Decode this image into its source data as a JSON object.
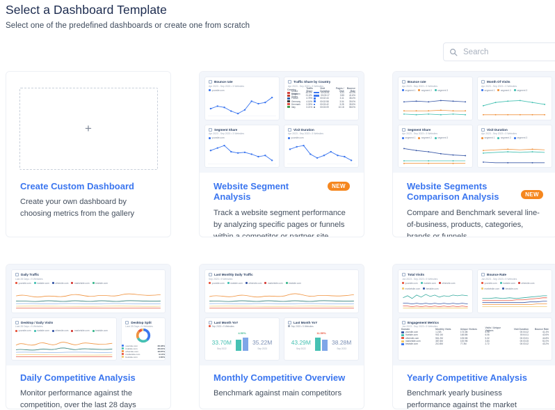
{
  "header": {
    "title": "Select a Dashboard Template",
    "subtitle": "Select one of the predefined dashboards or create one from scratch"
  },
  "search": {
    "placeholder": "Search",
    "value": "",
    "icon": "search-icon"
  },
  "badge_label": "NEW",
  "colors": {
    "link": "#3b76ef",
    "badge": "#f5871f",
    "title": "#1b2a4e",
    "thumb_bg": "#f3f6fb",
    "teal": "#46c1b3",
    "blue": "#7ea6e8",
    "orange": "#f0933f",
    "red": "#e8553e",
    "green": "#3fb98f"
  },
  "cards": [
    {
      "id": "create-custom-dashboard",
      "title": "Create Custom Dashboard",
      "description": "Create your own dashboard by choosing metrics from the gallery",
      "badge": null,
      "thumb_type": "blank",
      "plus_icon": "plus-icon"
    },
    {
      "id": "website-segment-analysis",
      "title": "Website Segment Analysis",
      "description": "Track a website segment performance by analyzing specific pages or funnels within a competitor or partner site",
      "badge": "NEW",
      "thumb_type": "panels",
      "panels": [
        {
          "name": "Bounce rate",
          "sub": "Apr 2023 - Sep 2023  •  3 Websites",
          "legend": [
            "yoursite.com"
          ],
          "type": "line"
        },
        {
          "name": "Traffic Share by Country",
          "sub": "Apr 2023 - Sep 2023  •  3 Websites",
          "type": "table",
          "columns": [
            "Country",
            "Traffic Share",
            "Visit Duration",
            "Pages / Visit",
            "Bounce Rate"
          ],
          "rows": [
            [
              "United Kingdom",
              "44.0%",
              "00:03:51",
              "4.21",
              "40.1%"
            ],
            [
              "United States",
              "21.6%",
              "00:03:17",
              "3.55",
              "41.6%"
            ],
            [
              "France",
              "4.78%",
              "00:02:44",
              "3.11",
              "38.4%"
            ],
            [
              "Germany",
              "4.16%",
              "00:02:58",
              "3.04",
              "39.0%"
            ],
            [
              "Denmark",
              "3.39%",
              "00:03:42",
              "3.28",
              "35.5%"
            ],
            [
              "Italy",
              "3.21%",
              "00:03:09",
              "10.18",
              "58.0%"
            ]
          ]
        },
        {
          "name": "Segment Share",
          "sub": "Apr 2023 - Sep 2023  •  3 Websites",
          "legend": [
            "yoursite.com"
          ],
          "type": "line"
        },
        {
          "name": "Visit Duration",
          "sub": "Apr 2023 - Sep 2023  •  3 Websites",
          "legend": [
            "yoursite.com"
          ],
          "type": "line"
        }
      ]
    },
    {
      "id": "website-segments-comparison-analysis",
      "title": "Website Segments Comparison Analysis",
      "description": "Compare and Benchmark several line-of-business, products, categories, brands or funnels",
      "badge": "NEW",
      "thumb_type": "panels",
      "panels": [
        {
          "name": "Bounce rate",
          "sub": "Apr 2023 - Sep 2023  •  3 Websites",
          "legend": [
            "segment 1",
            "segment 2",
            "segment 3"
          ],
          "type": "line-multi"
        },
        {
          "name": "Month Of Visits",
          "sub": "Apr 2023 - Sep 2023  •  3 Websites",
          "legend": [
            "segment 1",
            "segment 2",
            "segment 3"
          ],
          "type": "line-multi"
        },
        {
          "name": "Segment Share",
          "sub": "Apr 2023 - Sep 2023  •  3 Websites",
          "legend": [
            "segment 1",
            "segment 2",
            "segment 3"
          ],
          "type": "line-multi"
        },
        {
          "name": "Visit Duration",
          "sub": "Apr 2023 - Sep 2023  •  3 Websites",
          "legend": [
            "segment 1",
            "segment 2",
            "segment 3"
          ],
          "type": "line-multi"
        }
      ]
    },
    {
      "id": "daily-competitive-analysis",
      "title": "Daily Competitive Analysis",
      "description": "Monitor performance against the competition, over the last 28 days",
      "badge": null,
      "thumb_type": "panels",
      "panels": [
        {
          "name": "Daily Traffic",
          "sub": "Last 28 Days  •  5 Websites",
          "legend": [
            "yoursite.com",
            "rivalsite.com",
            "othersite.com",
            "marketsite.com",
            "bestsite.com"
          ],
          "type": "area-multi"
        },
        {
          "name": "Desktop / Daily Visits",
          "sub": "Last 28 Days  •  5 Websites",
          "legend": [
            "yoursite.com",
            "rivalsite.com",
            "othersite.com",
            "marketsite.com",
            "bestsite.com"
          ],
          "type": "area-multi"
        },
        {
          "name": "Desktop Split",
          "sub": "Last 28 Days  •  5 Websites",
          "type": "donut",
          "slices": [
            {
              "label": "yoursite.com",
              "value": "38.48%"
            },
            {
              "label": "rivalsite.com",
              "value": "28.91%"
            },
            {
              "label": "othersite.com",
              "value": "18.87%"
            },
            {
              "label": "marketsite.com",
              "value": "9.14%"
            },
            {
              "label": "bestsite.com",
              "value": "4.60%"
            }
          ]
        }
      ]
    },
    {
      "id": "monthly-competitive-overview",
      "title": "Monthly Competitive Overview",
      "description": "Benchmark against main competitors",
      "badge": null,
      "thumb_type": "panels",
      "panels": [
        {
          "name": "Last Monthly Daily Traffic",
          "sub": "Sep 2023  •  5 Websites",
          "legend": [
            "yoursite.com",
            "rivalsite.com",
            "othersite.com",
            "marketsite.com",
            "bestsite.com"
          ],
          "type": "area-multi"
        },
        {
          "name": "Last Month YoY",
          "sub": "Sep 2023  •  5 Websites",
          "type": "kpi",
          "left_value": "33.70M",
          "left_label": "Sep 2022",
          "right_value": "35.22M",
          "right_label": "Sep 2023",
          "pct": "4.50%",
          "direction": "up"
        },
        {
          "name": "Last Month YoY",
          "sub": "Sep 2023  •  5 Websites",
          "type": "kpi",
          "left_value": "43.29M",
          "left_label": "Sep 2022",
          "right_value": "38.28M",
          "right_label": "Sep 2023",
          "pct": "11.59%",
          "direction": "down"
        }
      ]
    },
    {
      "id": "yearly-competitive-analysis",
      "title": "Yearly Competitive Analysis",
      "description": "Benchmark yearly business performance against the market",
      "badge": null,
      "thumb_type": "panels",
      "panels": [
        {
          "name": "Total Visits",
          "sub": "Jan 2023 - Sep 2023  •  5 Websites",
          "legend": [
            "yoursite.com",
            "rivalsite.com",
            "othersite.com",
            "marketsite.com",
            "bestsite.com"
          ],
          "type": "line-dense"
        },
        {
          "name": "Bounce Rate",
          "sub": "Jan 2023 - Sep 2023  •  5 Websites",
          "legend": [
            "yoursite.com",
            "rivalsite.com",
            "othersite.com",
            "marketsite.com",
            "bestsite.com"
          ],
          "type": "line-dense"
        },
        {
          "name": "Engagement Metrics",
          "sub": "Jan 2023 - Sep 2023  •  5 Websites",
          "type": "table",
          "columns": [
            "Domain",
            "Monthly Visits",
            "Unique Visitors",
            "Visits / Unique Visitors",
            "Visit Duration",
            "Pages / Visit",
            "Bounce Rate"
          ],
          "rows": [
            [
              "yoursite.com",
              "1.21B",
              "173.4M",
              "6.98",
              "00:04:12",
              "5.91",
              "41.4%"
            ],
            [
              "rivalsite.com",
              "902.1M",
              "148.8M",
              "6.06",
              "00:04:11",
              "6.01",
              "42.6%"
            ],
            [
              "othersite.com",
              "561.2M",
              "105.5M",
              "5.32",
              "00:03:31",
              "5.24",
              "44.8%"
            ],
            [
              "marketsite.com",
              "387.6M",
              "100.9M",
              "3.84",
              "00:03:15",
              "5.11",
              "51.0%"
            ],
            [
              "bestsite.com",
              "210.8M",
              "77.3M",
              "2.72",
              "00:03:12",
              "4.01",
              "43.2%"
            ]
          ]
        }
      ]
    }
  ]
}
